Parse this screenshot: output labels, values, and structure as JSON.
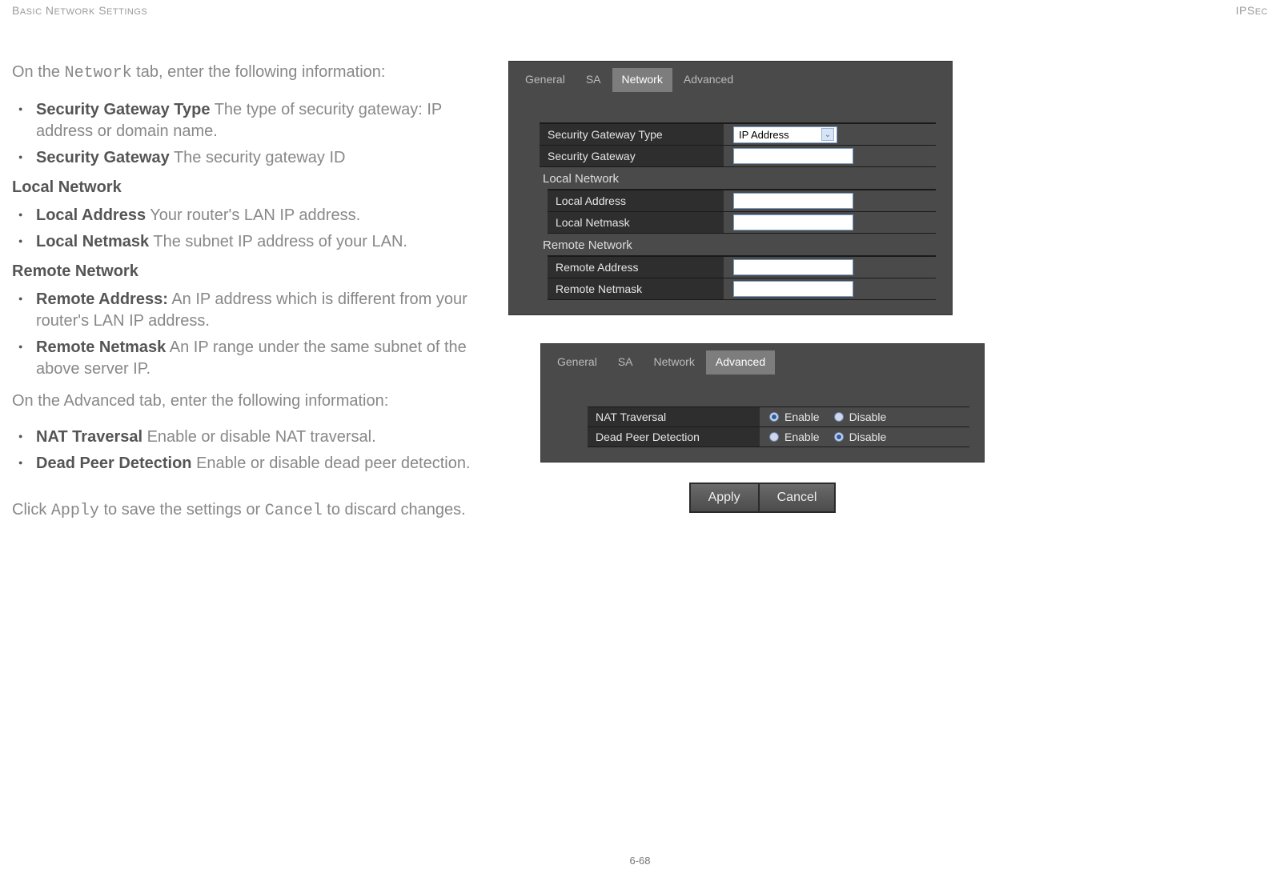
{
  "header": {
    "left": "BASIC NETWORK SETTINGS",
    "right": "IPSEC"
  },
  "intro1_a": "On the ",
  "intro1_b": "Network",
  "intro1_c": " tab, enter the following information:",
  "b1_bold": "Security Gateway Type",
  "b1_desc": "  The type of security gateway: IP address or domain name.",
  "b2_bold": "Security Gateway",
  "b2_desc": "  The security gateway ID",
  "h_local": "Local Network",
  "b3_bold": "Local Address",
  "b3_desc": "  Your router's LAN IP address.",
  "b4_bold": "Local Netmask",
  "b4_desc": "  The subnet IP address of your LAN.",
  "h_remote": "Remote Network",
  "b5_bold": "Remote Address:",
  "b5_desc": " An IP address which is different from your router's LAN IP address.",
  "b6_bold": "Remote Netmask",
  "b6_desc": " An IP range under the same subnet of the above server IP.",
  "intro2": "On the Advanced tab, enter the following information:",
  "b7_bold": "NAT Traversal",
  "b7_desc": " Enable or disable NAT traversal.",
  "b8_bold": "Dead Peer Detection",
  "b8_desc": " Enable or disable dead peer detection.",
  "click1": "Click ",
  "click_apply": "Apply",
  "click2": " to save the settings or ",
  "click_cancel": "Cancel",
  "click3": " to discard changes.",
  "panel1": {
    "tabs": [
      "General",
      "SA",
      "Network",
      "Advanced"
    ],
    "active": 2,
    "sg_type_label": "Security Gateway Type",
    "sg_type_value": "IP Address",
    "sg_label": "Security Gateway",
    "sg_value": "",
    "local_h": "Local Network",
    "local_addr_label": "Local Address",
    "local_addr_value": "",
    "local_mask_label": "Local Netmask",
    "local_mask_value": "",
    "remote_h": "Remote Network",
    "remote_addr_label": "Remote Address",
    "remote_addr_value": "",
    "remote_mask_label": "Remote Netmask",
    "remote_mask_value": ""
  },
  "panel2": {
    "tabs": [
      "General",
      "SA",
      "Network",
      "Advanced"
    ],
    "active": 3,
    "nat_label": "NAT Traversal",
    "dpd_label": "Dead Peer Detection",
    "enable": "Enable",
    "disable": "Disable",
    "nat_state": "enable",
    "dpd_state": "disable"
  },
  "buttons": {
    "apply": "Apply",
    "cancel": "Cancel"
  },
  "pagenum": "6-68"
}
